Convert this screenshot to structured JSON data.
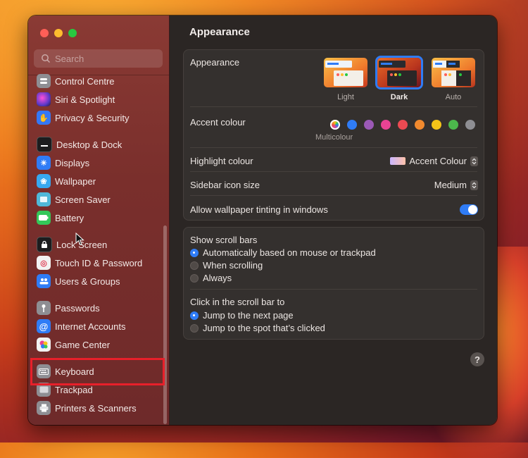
{
  "sidebar": {
    "search_placeholder": "Search",
    "items": [
      {
        "label": "Control Centre",
        "icon": "control-centre-icon",
        "color": "#8e8e93"
      },
      {
        "label": "Siri & Spotlight",
        "icon": "siri-icon",
        "color": "#5b39c9"
      },
      {
        "label": "Privacy & Security",
        "icon": "hand-icon",
        "color": "#3478f6"
      },
      {
        "label": "Desktop & Dock",
        "icon": "dock-icon",
        "color": "#1c1c1e"
      },
      {
        "label": "Displays",
        "icon": "sun-icon",
        "color": "#2f7cf6"
      },
      {
        "label": "Wallpaper",
        "icon": "wallpaper-icon",
        "color": "#37a8f0"
      },
      {
        "label": "Screen Saver",
        "icon": "screen-saver-icon",
        "color": "#50b8d8"
      },
      {
        "label": "Battery",
        "icon": "battery-icon",
        "color": "#34c759"
      },
      {
        "label": "Lock Screen",
        "icon": "lock-icon",
        "color": "#1c1c1e"
      },
      {
        "label": "Touch ID & Password",
        "icon": "fingerprint-icon",
        "color": "#f2f2f2"
      },
      {
        "label": "Users & Groups",
        "icon": "users-icon",
        "color": "#2f7cf6"
      },
      {
        "label": "Passwords",
        "icon": "key-icon",
        "color": "#8e8e93"
      },
      {
        "label": "Internet Accounts",
        "icon": "at-icon",
        "color": "#2f7cf6"
      },
      {
        "label": "Game Center",
        "icon": "game-center-icon",
        "color": "#f2f2f2"
      },
      {
        "label": "Keyboard",
        "icon": "keyboard-icon",
        "color": "#8e8e93"
      },
      {
        "label": "Trackpad",
        "icon": "trackpad-icon",
        "color": "#8e8e93"
      },
      {
        "label": "Printers & Scanners",
        "icon": "printer-icon",
        "color": "#8e8e93"
      }
    ]
  },
  "main": {
    "title": "Appearance",
    "appearance": {
      "label": "Appearance",
      "options": [
        {
          "label": "Light",
          "selected": false
        },
        {
          "label": "Dark",
          "selected": true
        },
        {
          "label": "Auto",
          "selected": false
        }
      ]
    },
    "accent": {
      "label": "Accent colour",
      "caption": "Multicolour",
      "colors": [
        "multicolour",
        "#2f7cf6",
        "#9b59b6",
        "#e84393",
        "#ec4a52",
        "#f28a2e",
        "#f5c518",
        "#4cb84c",
        "#8e8e93"
      ]
    },
    "highlight": {
      "label": "Highlight colour",
      "value": "Accent Colour"
    },
    "sidebar_icon_size": {
      "label": "Sidebar icon size",
      "value": "Medium"
    },
    "wallpaper_tinting": {
      "label": "Allow wallpaper tinting in windows",
      "enabled": true
    },
    "scroll_bars": {
      "label": "Show scroll bars",
      "options": [
        {
          "label": "Automatically based on mouse or trackpad",
          "selected": true
        },
        {
          "label": "When scrolling",
          "selected": false
        },
        {
          "label": "Always",
          "selected": false
        }
      ]
    },
    "click_scroll": {
      "label": "Click in the scroll bar to",
      "options": [
        {
          "label": "Jump to the next page",
          "selected": true
        },
        {
          "label": "Jump to the spot that’s clicked",
          "selected": false
        }
      ]
    },
    "help_label": "?"
  }
}
